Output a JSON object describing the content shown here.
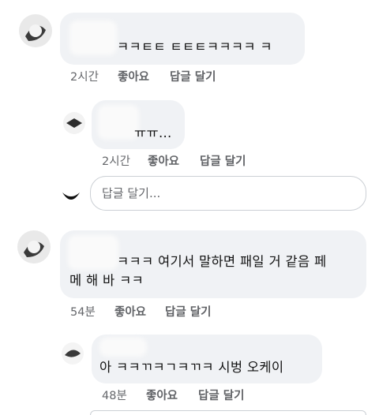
{
  "comments": [
    {
      "text": "ㅋㅋㅌㅌ ㅌㅌㅌㅋㅋㅋㅋ ㅋ",
      "time": "2시간",
      "like": "좋아요",
      "reply": "답글 달기"
    },
    {
      "text": "ㅠㅠ...",
      "time": "2시간",
      "like": "좋아요",
      "reply": "답글 달기"
    },
    {
      "text_line1": "ㅋㅋㅋ 여기서 말하면 패일 거 같음 페",
      "text_line2": "메 해 바 ㅋㅋ",
      "time": "54분",
      "like": "좋아요",
      "reply": "답글 달기"
    },
    {
      "text": "아 ㅋㅋㄲㅋㄱㅋㄲㅋ 시벙 오케이",
      "time": "48분",
      "like": "좋아요",
      "reply": "답글 달기"
    }
  ],
  "reply_input": {
    "placeholder": "답글 달기..."
  }
}
